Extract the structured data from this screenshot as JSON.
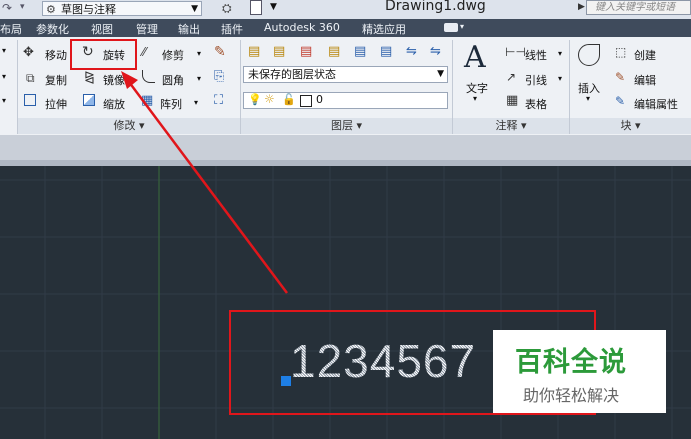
{
  "titlebar": {
    "workspace": "草图与注释",
    "document": "Drawing1.dwg",
    "search_placeholder": "键入关键字或短语"
  },
  "menu": {
    "tabs": [
      "布局",
      "参数化",
      "视图",
      "管理",
      "输出",
      "插件",
      "Autodesk 360",
      "精选应用"
    ]
  },
  "ribbon": {
    "modify": {
      "title": "修改 ▾",
      "move": "移动",
      "rotate": "旋转",
      "trim": "修剪",
      "copy": "复制",
      "mirror": "镜像",
      "fillet": "圆角",
      "stretch": "拉伸",
      "scale": "缩放",
      "array": "阵列"
    },
    "layers": {
      "title": "图层 ▾",
      "state": "未保存的图层状态",
      "current_layer": "0"
    },
    "annotation": {
      "title": "注释 ▾",
      "text": "文字",
      "linear": "线性",
      "leader": "引线",
      "table": "表格"
    },
    "block": {
      "title": "块 ▾",
      "insert": "插入",
      "create": "创建",
      "edit": "编辑",
      "edit_attributes": "编辑属性"
    }
  },
  "drawing": {
    "text": "1234567"
  },
  "watermark": {
    "title": "百科全说",
    "subtitle": "助你轻松解决"
  },
  "colors": {
    "highlight": "#e0161b",
    "canvas": "#263039",
    "grip": "#1e7fe6",
    "watermark_green": "#2c9a3a"
  }
}
